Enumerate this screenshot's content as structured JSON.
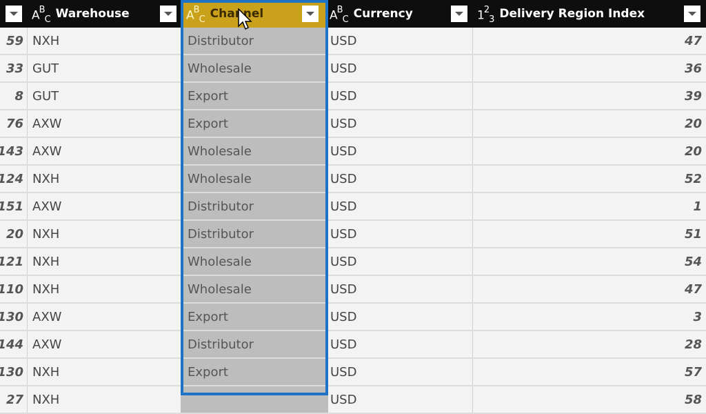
{
  "columns": [
    {
      "id": "index",
      "type_icon": "",
      "label": ""
    },
    {
      "id": "warehouse",
      "type_icon": "text-type",
      "type_glyph": [
        "A",
        "B",
        "C"
      ],
      "label": "Warehouse"
    },
    {
      "id": "channel",
      "type_icon": "text-type",
      "type_glyph": [
        "A",
        "B",
        "C"
      ],
      "label": "Channel",
      "selected": true
    },
    {
      "id": "currency",
      "type_icon": "text-type",
      "type_glyph": [
        "A",
        "B",
        "C"
      ],
      "label": "Currency"
    },
    {
      "id": "delivery_region_index",
      "type_icon": "number-type",
      "type_glyph": [
        "1",
        "2",
        "3"
      ],
      "label": "Delivery Region Index"
    }
  ],
  "rows": [
    {
      "index": "59",
      "warehouse": "NXH",
      "channel": "Distributor",
      "currency": "USD",
      "dri": "47"
    },
    {
      "index": "33",
      "warehouse": "GUT",
      "channel": "Wholesale",
      "currency": "USD",
      "dri": "36"
    },
    {
      "index": "8",
      "warehouse": "GUT",
      "channel": "Export",
      "currency": "USD",
      "dri": "39"
    },
    {
      "index": "76",
      "warehouse": "AXW",
      "channel": "Export",
      "currency": "USD",
      "dri": "20"
    },
    {
      "index": "143",
      "warehouse": "AXW",
      "channel": "Wholesale",
      "currency": "USD",
      "dri": "20"
    },
    {
      "index": "124",
      "warehouse": "NXH",
      "channel": "Wholesale",
      "currency": "USD",
      "dri": "52"
    },
    {
      "index": "151",
      "warehouse": "AXW",
      "channel": "Distributor",
      "currency": "USD",
      "dri": "1"
    },
    {
      "index": "20",
      "warehouse": "NXH",
      "channel": "Distributor",
      "currency": "USD",
      "dri": "51"
    },
    {
      "index": "121",
      "warehouse": "NXH",
      "channel": "Wholesale",
      "currency": "USD",
      "dri": "54"
    },
    {
      "index": "110",
      "warehouse": "NXH",
      "channel": "Wholesale",
      "currency": "USD",
      "dri": "47"
    },
    {
      "index": "130",
      "warehouse": "AXW",
      "channel": "Export",
      "currency": "USD",
      "dri": "3"
    },
    {
      "index": "144",
      "warehouse": "AXW",
      "channel": "Distributor",
      "currency": "USD",
      "dri": "28"
    },
    {
      "index": "130",
      "warehouse": "NXH",
      "channel": "Export",
      "currency": "USD",
      "dri": "57"
    },
    {
      "index": "27",
      "warehouse": "NXH",
      "channel": "",
      "currency": "USD",
      "dri": "58"
    }
  ],
  "colors": {
    "header_bg": "#0e0e0e",
    "selected_header": "#c9a11a",
    "selection_border": "#1e73c7",
    "selected_cell": "#bdbdbd"
  }
}
